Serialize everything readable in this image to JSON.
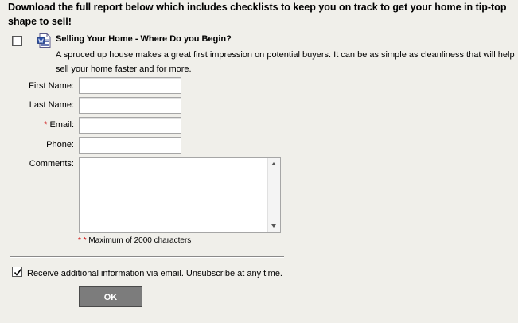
{
  "intro_text": "Download the full report below which includes checklists to keep you on track to get your home in tip-top shape to sell!",
  "report": {
    "checked": false,
    "icon": "word-document-icon",
    "title": "Selling Your Home - Where Do you Begin?",
    "description": "A spruced up house makes a great first impression on potential buyers. It can be as simple as cleanliness that will help sell your home faster and for more."
  },
  "form": {
    "first_name_label": "First Name:",
    "last_name_label": "Last Name:",
    "email_required_mark": "*",
    "email_label": "Email:",
    "phone_label": "Phone:",
    "comments_label": "Comments:",
    "first_name_value": "",
    "last_name_value": "",
    "email_value": "",
    "phone_value": "",
    "comments_value": "",
    "comments_note_marks": "* *",
    "comments_note": "Maximum of 2000 characters"
  },
  "optin": {
    "checked": true,
    "label": "Receive additional information via email. Unsubscribe at any time."
  },
  "submit_label": "OK",
  "colors": {
    "background": "#f0efea",
    "required": "#cc0000",
    "button": "#7c7c7c"
  }
}
